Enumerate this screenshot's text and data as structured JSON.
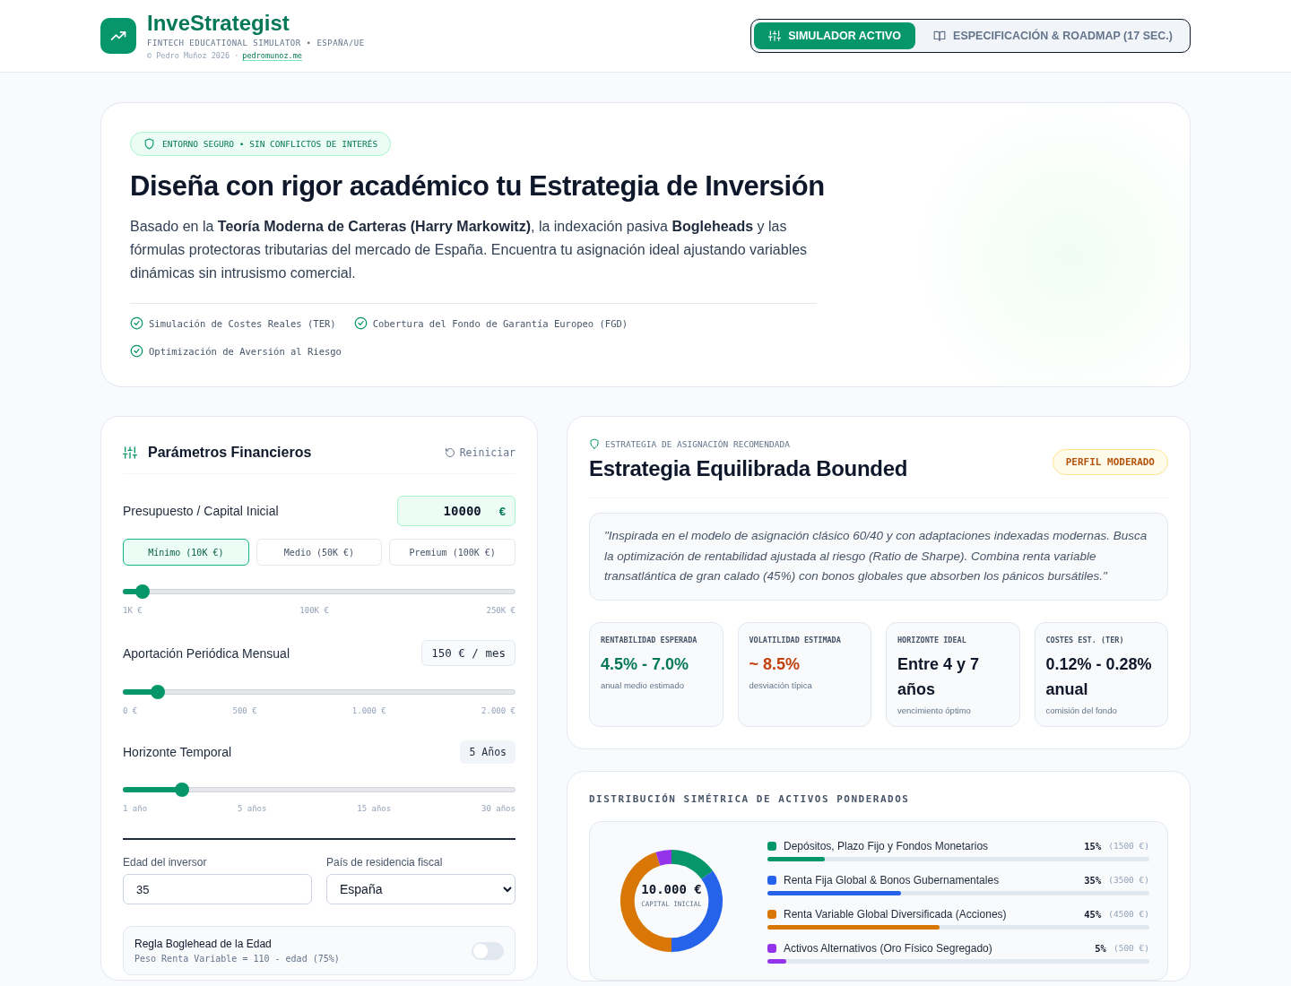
{
  "header": {
    "brand": "InveStrategist",
    "tagline": "FINTECH EDUCATIONAL SIMULATOR • ESPAÑA/UE",
    "credit": "© Pedro Muñoz 2026 ·",
    "link": "pedromunoz.me",
    "nav": [
      {
        "label": "SIMULADOR ACTIVO",
        "selected": true
      },
      {
        "label": "ESPECIFICACIÓN & ROADMAP (17 SEC.)",
        "selected": false
      }
    ]
  },
  "hero": {
    "badge": "ENTORNO SEGURO • SIN CONFLICTOS DE INTERÉS",
    "title": "Diseña con rigor académico tu Estrategia de Inversión",
    "text": "Basado en la **Teoría Moderna de Carteras (Harry Markowitz)**, la indexación pasiva **Bogleheads** y las fórmulas protectoras tributarias del mercado de España. Encuentra tu asignación ideal ajustando variables dinámicas sin intrusismo comercial.",
    "features": [
      "Simulación de Costes Reales (TER)",
      "Cobertura del Fondo de Garantía Europeo (FGD)",
      "Optimización de Aversión al Riesgo"
    ]
  },
  "parameters": {
    "title": "Parámetros Financieros",
    "reset": "Reiniciar",
    "sliders": [
      {
        "kind": "field",
        "label": "Presupuesto / Capital Inicial",
        "value": "10000",
        "unit": "€",
        "presets": [
          {
            "label": "Mínimo (10K €)",
            "selected": true
          },
          {
            "label": "Medio (50K €)",
            "selected": false
          },
          {
            "label": "Premium (100K €)",
            "selected": false
          }
        ],
        "level": 0.05,
        "ticks": [
          "1K €",
          "100K €",
          "250K €"
        ]
      },
      {
        "kind": "outlined",
        "label": "Aportación Periódica Mensual",
        "reading": "150 € / mes",
        "level": 0.09,
        "ticks": [
          "0 €",
          "500 €",
          "1.000 €",
          "2.000 €"
        ]
      },
      {
        "kind": "filled",
        "label": "Horizonte Temporal",
        "reading": "5 Años",
        "level": 0.15,
        "ticks": [
          "1 año",
          "5 años",
          "15 años",
          "30 años"
        ]
      }
    ],
    "age": {
      "label": "Edad del inversor",
      "value": "35"
    },
    "country": {
      "label": "País de residencia fiscal",
      "value": "España"
    },
    "rule": {
      "title": "Regla Boglehead de la Edad",
      "formula": "Peso Renta Variable = 110 - edad (75%)",
      "on": false
    }
  },
  "strategy": {
    "eyebrow": "ESTRATEGIA DE ASIGNACIÓN RECOMENDADA",
    "title": "Estrategia Equilibrada Bounded",
    "profile": "PERFIL MODERADO",
    "quote": "\"Inspirada en el modelo de asignación clásico 60/40 y con adaptaciones indexadas modernas. Busca la optimización de rentabilidad ajustada al riesgo (Ratio de Sharpe). Combina renta variable transatlántica de gran calado (45%) con bonos globales que absorben los pánicos bursátiles.\"",
    "metrics": [
      {
        "label": "RENTABILIDAD ESPERADA",
        "value": "4.5% - 7.0%",
        "note": "anual medio estimado",
        "color": "#047857"
      },
      {
        "label": "VOLATILIDAD ESTIMADA",
        "value": "~ 8.5%",
        "note": "desviación típica",
        "color": "#c2410c"
      },
      {
        "label": "HORIZONTE IDEAL",
        "value": "Entre 4 y 7 años",
        "note": "vencimiento óptimo",
        "color": "#0f172a"
      },
      {
        "label": "COSTES EST. (TER)",
        "value": "0.12% - 0.28% anual",
        "note": "comisión del fondo",
        "color": "#0f172a"
      }
    ]
  },
  "distribution": {
    "title": "DISTRIBUCIÓN SIMÉTRICA DE ACTIVOS PONDERADOS",
    "center_value": "10.000 €",
    "center_label": "CAPITAL INICIAL",
    "chart_data": {
      "type": "donut",
      "categories": [
        "Depósitos, Plazo Fijo y Fondos Monetarios",
        "Renta Fija Global & Bonos Gubernamentales",
        "Renta Variable Global Diversificada (Acciones)",
        "Activos Alternativos (Oro Físico Segregado)"
      ],
      "values": [
        15,
        35,
        45,
        5
      ]
    },
    "assets": [
      {
        "percent": "15%",
        "amount": "(1500 €)",
        "level": 0.15,
        "color": "#059669"
      },
      {
        "percent": "35%",
        "amount": "(3500 €)",
        "level": 0.35,
        "color": "#2563eb"
      },
      {
        "percent": "45%",
        "amount": "(4500 €)",
        "level": 0.45,
        "color": "#d97706"
      },
      {
        "percent": "5%",
        "amount": "(500 €)",
        "level": 0.05,
        "color": "#9333ea"
      }
    ]
  }
}
